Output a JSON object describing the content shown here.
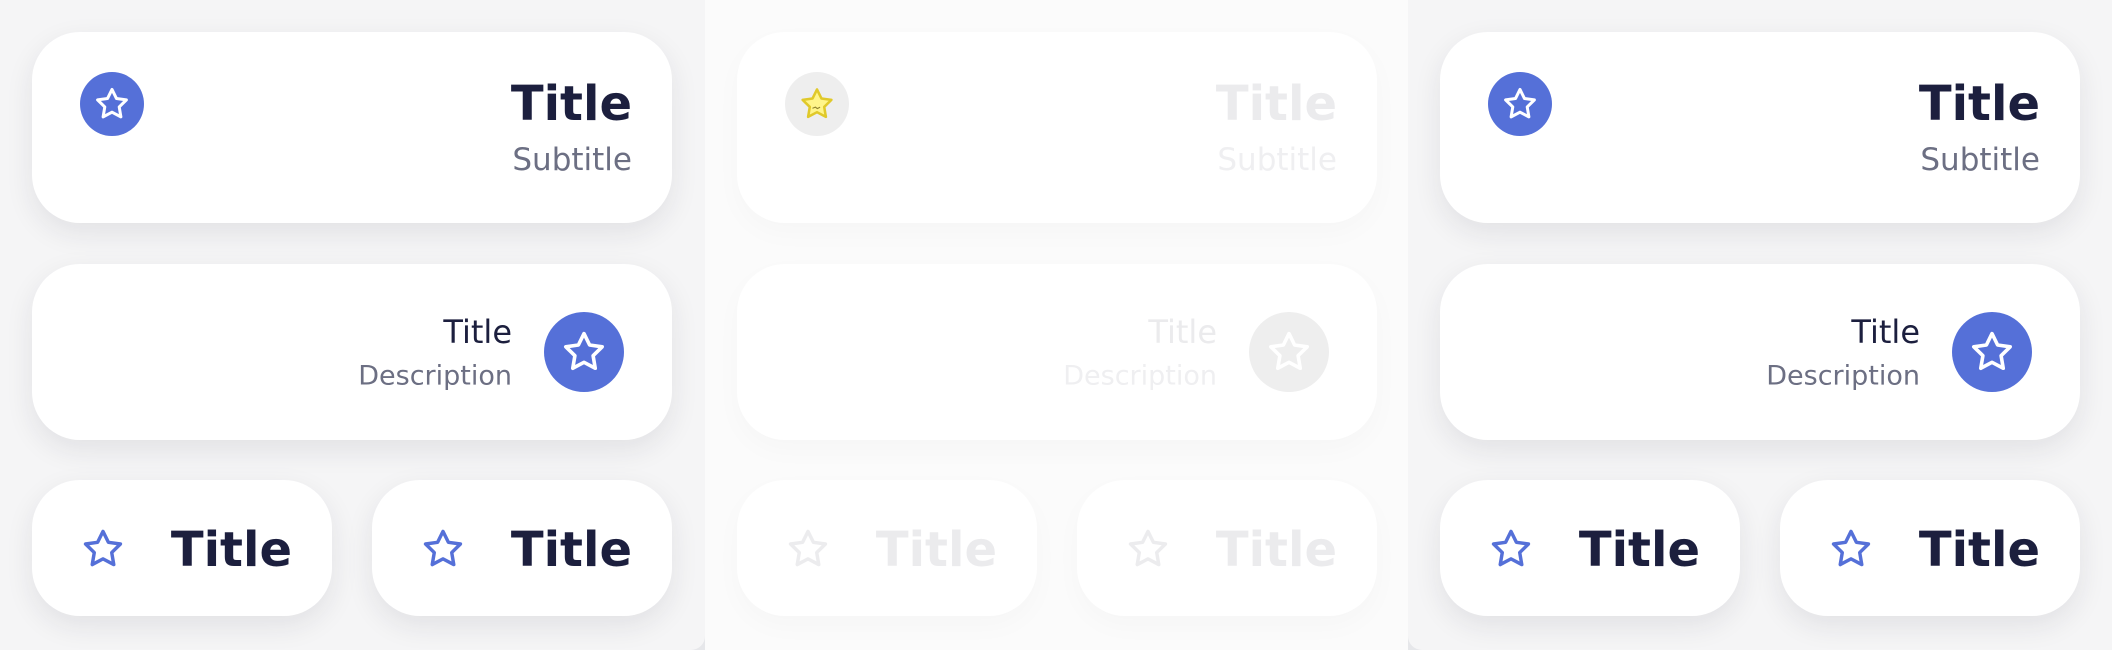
{
  "colors": {
    "accent": "#5570d8",
    "title": "#1c1f3e",
    "secondary": "#6c6f83",
    "disabled_fill": "#eeeeee",
    "disabled_text": "#ebebed",
    "highlight_star": "#f6e94a"
  },
  "panels": [
    {
      "state": "default",
      "card_a": {
        "icon": "star-icon",
        "title": "Title",
        "subtitle": "Subtitle"
      },
      "card_b": {
        "icon": "star-icon",
        "title": "Title",
        "description": "Description"
      },
      "card_c": [
        {
          "icon": "star-icon",
          "title": "Title"
        },
        {
          "icon": "star-icon",
          "title": "Title"
        }
      ]
    },
    {
      "state": "disabled",
      "card_a": {
        "icon": "star-icon",
        "title": "Title",
        "subtitle": "Subtitle"
      },
      "card_b": {
        "icon": "star-icon",
        "title": "Title",
        "description": "Description"
      },
      "card_c": [
        {
          "icon": "star-icon",
          "title": "Title"
        },
        {
          "icon": "star-icon",
          "title": "Title"
        }
      ]
    },
    {
      "state": "default",
      "card_a": {
        "icon": "star-icon",
        "title": "Title",
        "subtitle": "Subtitle"
      },
      "card_b": {
        "icon": "star-icon",
        "title": "Title",
        "description": "Description"
      },
      "card_c": [
        {
          "icon": "star-icon",
          "title": "Title"
        },
        {
          "icon": "star-icon",
          "title": "Title"
        }
      ]
    }
  ]
}
